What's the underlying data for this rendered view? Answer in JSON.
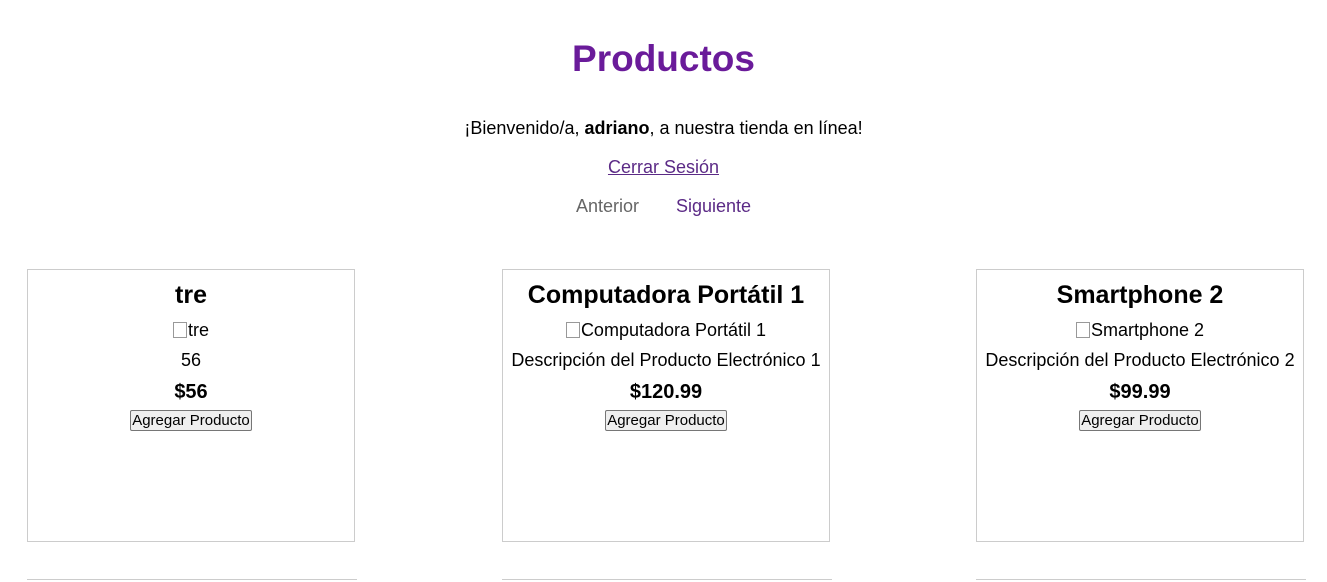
{
  "header": {
    "title": "Productos",
    "welcome_prefix": "¡Bienvenido/a, ",
    "username": "adriano",
    "welcome_suffix": ", a nuestra tienda en línea!",
    "logout_label": "Cerrar Sesión"
  },
  "pagination": {
    "prev_label": "Anterior",
    "next_label": "Siguiente"
  },
  "products": [
    {
      "name": "tre",
      "image_alt": "tre",
      "description": "56",
      "price": "$56",
      "button_label": "Agregar Producto"
    },
    {
      "name": "Computadora Portátil 1",
      "image_alt": "Computadora Portátil 1",
      "description": "Descripción del Producto Electrónico 1",
      "price": "$120.99",
      "button_label": "Agregar Producto"
    },
    {
      "name": "Smartphone 2",
      "image_alt": "Smartphone 2",
      "description": "Descripción del Producto Electrónico 2",
      "price": "$99.99",
      "button_label": "Agregar Producto"
    }
  ],
  "colors": {
    "title": "#6a1b9a",
    "link": "#5b2a86",
    "disabled": "#666666",
    "card_border": "#cccccc"
  }
}
